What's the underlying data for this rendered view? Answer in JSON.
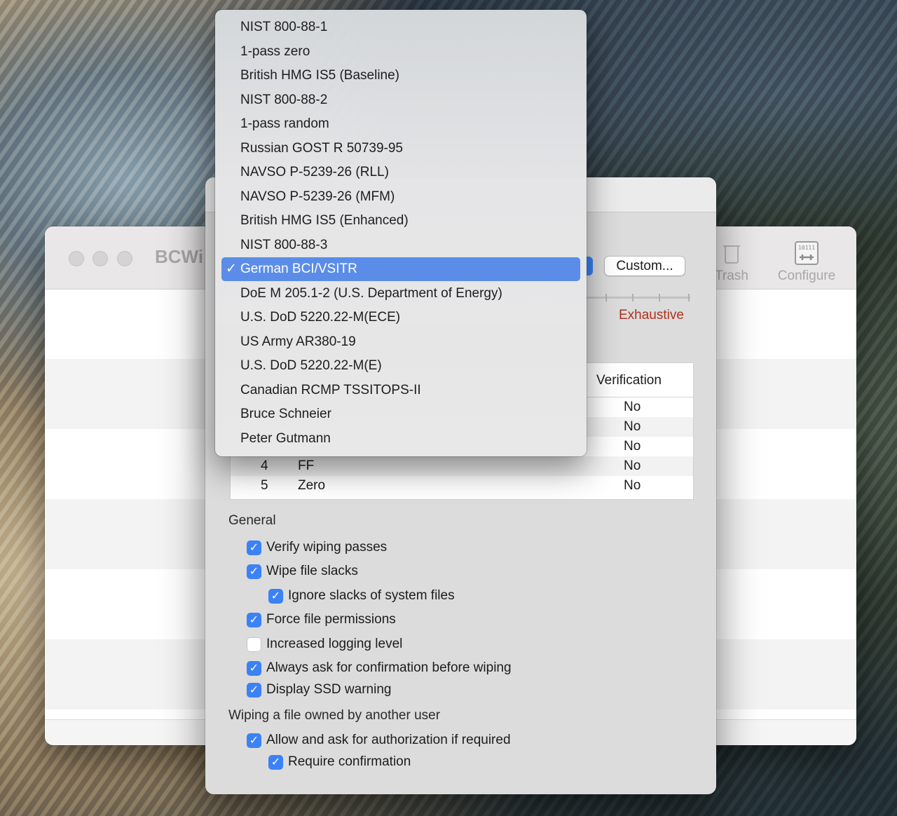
{
  "main_window": {
    "title": "BCWi",
    "toolbar": [
      {
        "label": "Trash",
        "icon": "trash-icon"
      },
      {
        "label": "Configure",
        "icon": "configure-icon"
      }
    ]
  },
  "sheet": {
    "custom_button": "Custom...",
    "slider_max_label": "Exhaustive",
    "passes_table": {
      "header_verification": "Verification",
      "visible_rows": [
        {
          "verification": "No"
        },
        {
          "verification": "No"
        },
        {
          "verification": "No"
        },
        {
          "num": "4",
          "pattern": "FF",
          "verification": "No"
        },
        {
          "num": "5",
          "pattern": "Zero",
          "verification": "No"
        }
      ]
    },
    "general": {
      "title": "General",
      "options": [
        {
          "label": "Verify wiping passes",
          "checked": true
        },
        {
          "label": "Wipe file slacks",
          "checked": true
        },
        {
          "label": "Ignore slacks of system files",
          "checked": true
        },
        {
          "label": "Force file permissions",
          "checked": true
        },
        {
          "label": "Increased logging level",
          "checked": false
        },
        {
          "label": "Always ask for confirmation before wiping",
          "checked": true
        },
        {
          "label": "Display SSD warning",
          "checked": true
        }
      ]
    },
    "other_user": {
      "title": "Wiping a file owned by another user",
      "options": [
        {
          "label": "Allow and ask for authorization if required",
          "checked": true
        },
        {
          "label": "Require confirmation",
          "checked": true
        }
      ]
    }
  },
  "dropdown": {
    "selected_index": 10,
    "check_glyph": "✓",
    "items": [
      "NIST 800-88-1",
      "1-pass zero",
      "British HMG IS5 (Baseline)",
      "NIST 800-88-2",
      "1-pass random",
      "Russian GOST R 50739-95",
      "NAVSO P-5239-26 (RLL)",
      "NAVSO P-5239-26 (MFM)",
      "British HMG IS5 (Enhanced)",
      "NIST 800-88-3",
      "German BCI/VSITR",
      "DoE M 205.1-2 (U.S. Department of Energy)",
      "U.S. DoD 5220.22-M(ECE)",
      "US Army AR380-19",
      "U.S. DoD 5220.22-M(E)",
      "Canadian RCMP TSSITOPS-II",
      "Bruce Schneier",
      "Peter Gutmann"
    ]
  }
}
